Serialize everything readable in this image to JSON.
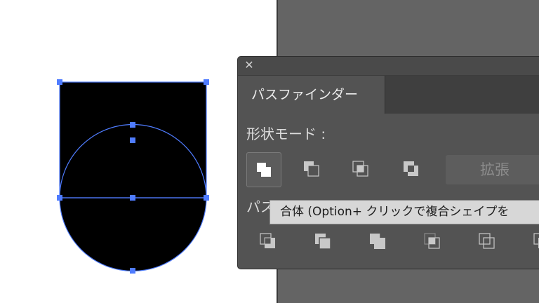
{
  "canvas": {
    "artboard_color": "#ffffff",
    "pasteboard_color": "#646464",
    "shape_fill": "#000000",
    "selection_color": "#4f7cff"
  },
  "panel": {
    "close_glyph": "✕",
    "tab_label": "パスファインダー",
    "shape_modes_label": "形状モード :",
    "shape_mode_buttons": [
      {
        "name": "unite",
        "icon": "unite-icon"
      },
      {
        "name": "minus-front",
        "icon": "minus-front-icon"
      },
      {
        "name": "intersect",
        "icon": "intersect-icon"
      },
      {
        "name": "exclude",
        "icon": "exclude-icon"
      }
    ],
    "expand_label": "拡張",
    "pathfinders_label": "パス",
    "pathfinder_buttons": [
      {
        "name": "divide",
        "icon": "divide-icon"
      },
      {
        "name": "trim",
        "icon": "trim-icon"
      },
      {
        "name": "merge",
        "icon": "merge-icon"
      },
      {
        "name": "crop",
        "icon": "crop-icon"
      },
      {
        "name": "outline",
        "icon": "outline-icon"
      },
      {
        "name": "minus-back",
        "icon": "minus-back-icon"
      }
    ]
  },
  "tooltip": {
    "text": "合体 (Option+ クリックで複合シェイプを"
  }
}
